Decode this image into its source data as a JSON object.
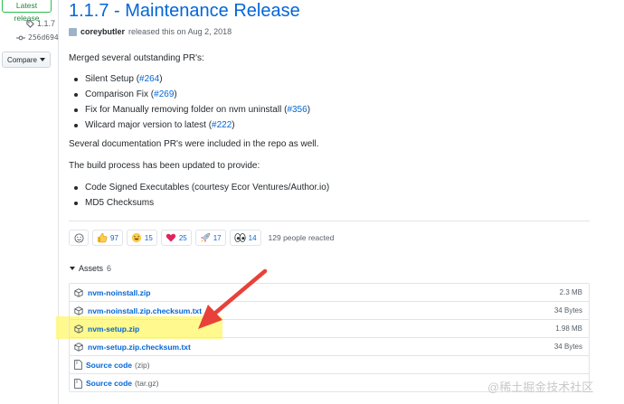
{
  "sidebar": {
    "latest_badge": "Latest release",
    "tag": "1.1.7",
    "commit": "256d694",
    "compare_label": "Compare"
  },
  "release": {
    "title": "1.1.7 - Maintenance Release",
    "author": "coreybutler",
    "released_text": "released this on Aug 2, 2018"
  },
  "body": {
    "intro": "Merged several outstanding PR's:",
    "pr_items": [
      {
        "text": "Silent Setup (",
        "link": "#264",
        "suffix": ")"
      },
      {
        "text": "Comparison Fix (",
        "link": "#269",
        "suffix": ")"
      },
      {
        "text": "Fix for Manually removing folder on nvm uninstall (",
        "link": "#356",
        "suffix": ")"
      },
      {
        "text": "Wilcard major version to latest (",
        "link": "#222",
        "suffix": ")"
      }
    ],
    "docs_note": "Several documentation PR's were included in the repo as well.",
    "build_intro": "The build process has been updated to provide:",
    "build_items": [
      "Code Signed Executables (courtesy Ecor Ventures/Author.io)",
      "MD5 Checksums"
    ]
  },
  "reactions": {
    "items": [
      {
        "icon": "thumbs-up-icon",
        "count": "97"
      },
      {
        "icon": "laugh-icon",
        "count": "15"
      },
      {
        "icon": "heart-icon",
        "count": "25"
      },
      {
        "icon": "rocket-icon",
        "count": "17"
      },
      {
        "icon": "eyes-icon",
        "count": "14"
      }
    ],
    "summary": "129 people reacted"
  },
  "assets": {
    "label": "Assets",
    "count": "6",
    "files": [
      {
        "name": "nvm-noinstall.zip",
        "size": "2.3 MB"
      },
      {
        "name": "nvm-noinstall.zip.checksum.txt",
        "size": "34 Bytes"
      },
      {
        "name": "nvm-setup.zip",
        "size": "1.98 MB"
      },
      {
        "name": "nvm-setup.zip.checksum.txt",
        "size": "34 Bytes"
      }
    ],
    "sources": [
      {
        "label": "Source code",
        "format": "(zip)"
      },
      {
        "label": "Source code",
        "format": "(tar.gz)"
      }
    ]
  },
  "watermark": "@稀土掘金技术社区",
  "colors": {
    "link": "#0366d6",
    "highlight": "#fff87a",
    "arrow": "#e8413a",
    "latest_badge": "#2cbe4e"
  }
}
